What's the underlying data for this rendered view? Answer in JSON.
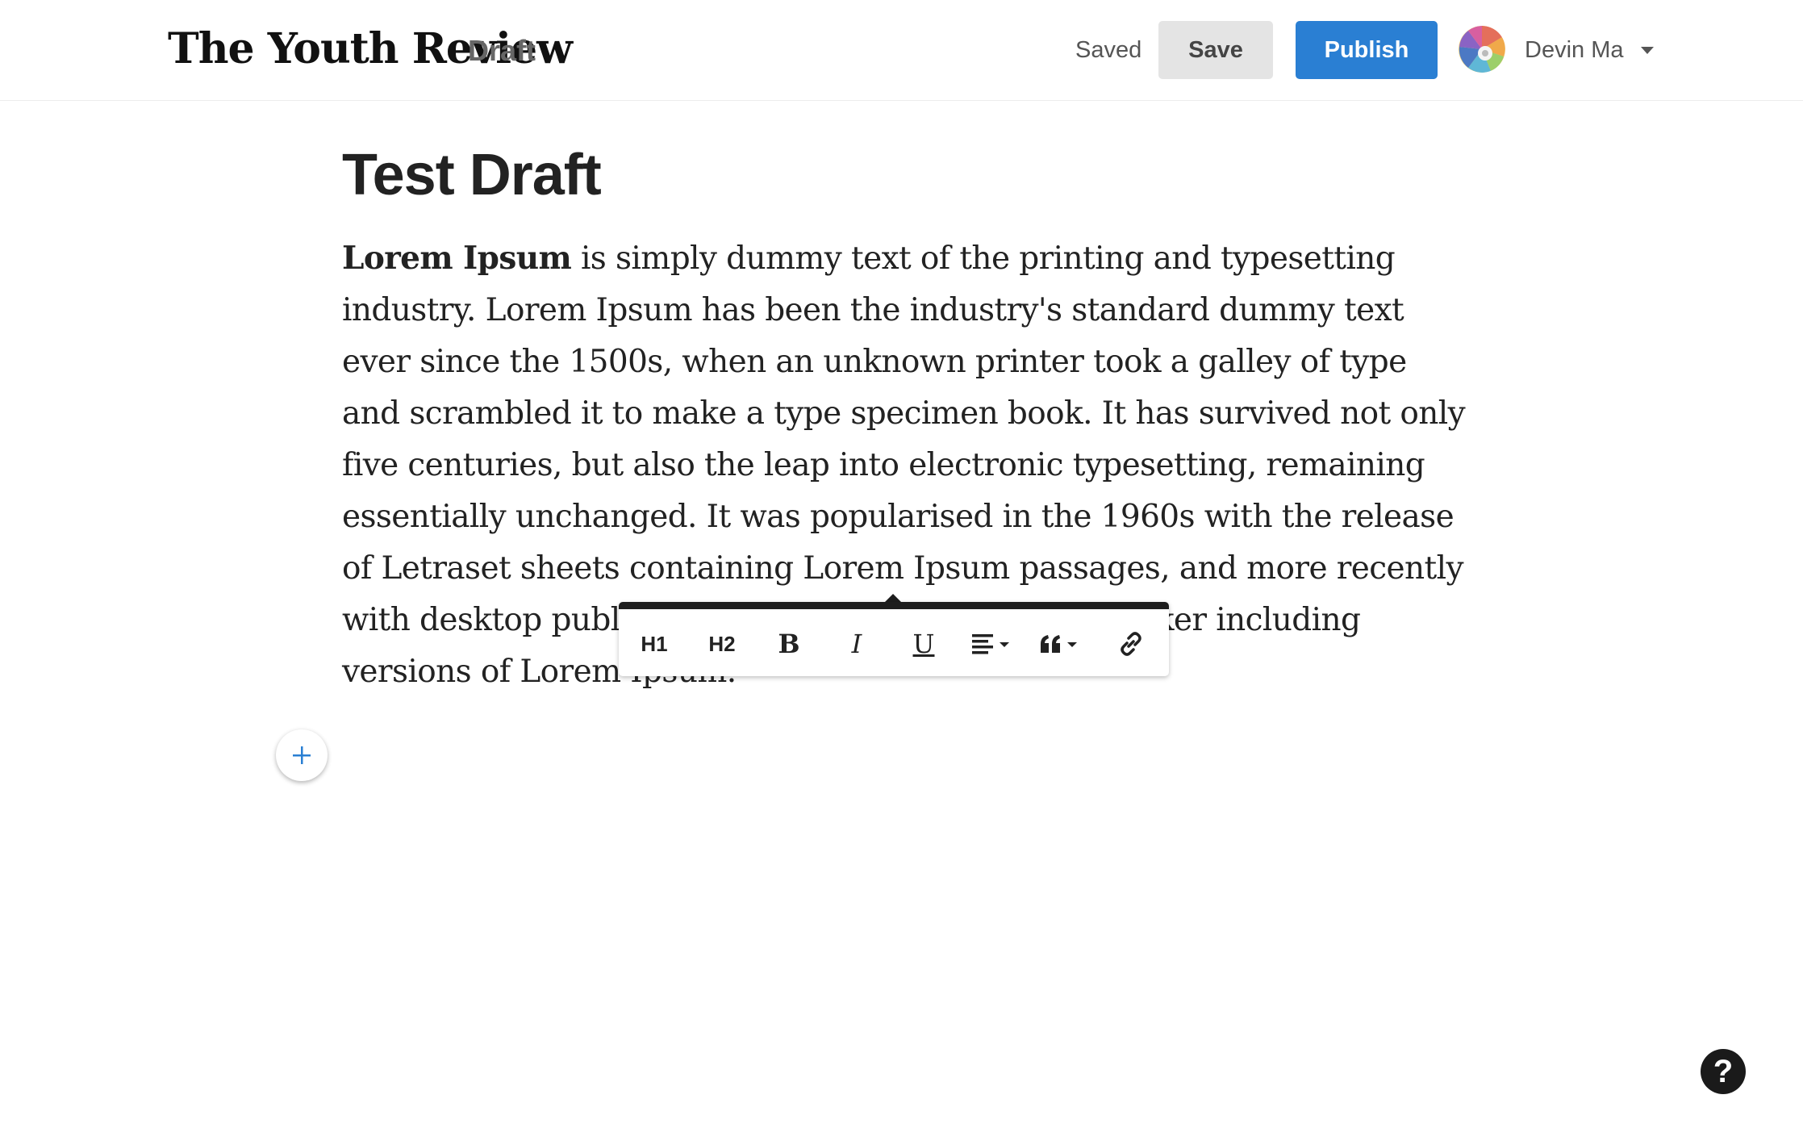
{
  "header": {
    "logo_text": "The Youth Review",
    "status_label": "Draft",
    "save_status": "Saved",
    "save_label": "Save",
    "publish_label": "Publish",
    "user_name": "Devin Ma",
    "avatar_icon": "user-avatar-icon",
    "menu_icon": "caret-down-icon"
  },
  "document": {
    "title": "Test Draft",
    "body_bold_lead": "Lorem Ipsum",
    "body_text": " is simply dummy text of the printing and typesetting industry. Lorem Ipsum has been the industry's standard dummy text ever since the 1500s, when an unknown printer took a galley of type and scrambled it to make a type specimen book. It has survived not only five centuries, but also the leap into electronic typesetting, remaining essentially unchanged. It was popularised in the 1960s with the release of Letraset sheets containing Lorem Ipsum passages, and more recently with desktop publishing software like Aldus PageMaker including versions of Lorem Ipsum."
  },
  "toolbar": {
    "h1_label": "H1",
    "h2_label": "H2",
    "bold_label": "B",
    "italic_label": "I",
    "underline_label": "U",
    "align_icon": "align-left-icon",
    "quote_icon": "quote-icon",
    "link_icon": "link-icon"
  },
  "add_block_icon": "plus-icon",
  "help_label": "?",
  "colors": {
    "accent": "#2a7fd3",
    "save_button_bg": "#e4e4e4",
    "toolbar_border": "#1d1d1d",
    "text": "#222222"
  }
}
